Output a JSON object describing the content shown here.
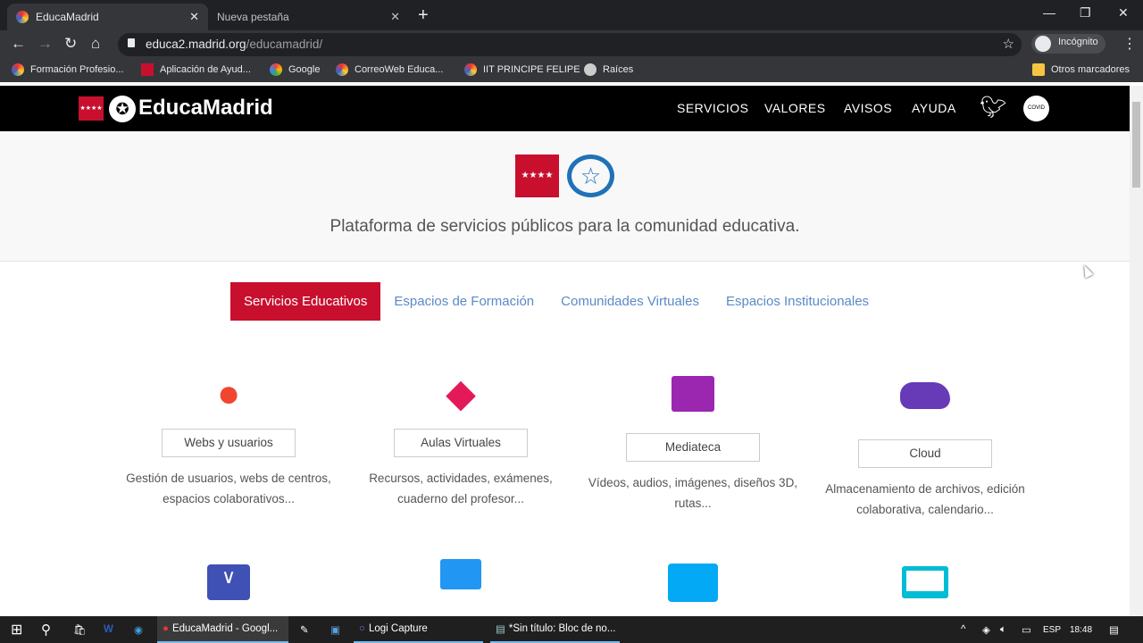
{
  "browser": {
    "tabs": [
      {
        "label": "EducaMadrid",
        "active": true
      },
      {
        "label": "Nueva pestaña",
        "active": false
      }
    ],
    "url_host": "educa2.madrid.org",
    "url_path": "/educamadrid/",
    "profile": "Incógnito",
    "bookmarks": [
      "Formación Profesio...",
      "Aplicación de Ayud...",
      "Google",
      "CorreoWeb Educa...",
      "IIT PRINCIPE FELIPE",
      "Raíces"
    ],
    "other_bookmarks": "Otros marcadores"
  },
  "site": {
    "logo": "EducaMadrid",
    "nav": [
      "SERVICIOS",
      "VALORES",
      "AVISOS",
      "AYUDA"
    ],
    "covid_badge": "COVID",
    "tagline": "Plataforma de servicios públicos para la comunidad educativa.",
    "tabs": [
      {
        "label": "Servicios Educativos",
        "selected": true
      },
      {
        "label": "Espacios de Formación"
      },
      {
        "label": "Comunidades Virtuales"
      },
      {
        "label": "Espacios Institucionales"
      }
    ],
    "cards": [
      {
        "title": "Webs y usuarios",
        "desc": "Gestión de usuarios, webs de centros, espacios colaborativos...",
        "icon": "users-icon",
        "color": "#f0452f"
      },
      {
        "title": "Aulas Virtuales",
        "desc": "Recursos, actividades, exámenes, cuaderno del profesor...",
        "icon": "graduation-cap-icon",
        "color": "#e3195a"
      },
      {
        "title": "Mediateca",
        "desc": "Vídeos, audios, imágenes, diseños 3D, rutas...",
        "icon": "clapperboard-icon",
        "color": "#9b27b0"
      },
      {
        "title": "Cloud",
        "desc": "Almacenamiento de archivos, edición colaborativa, calendario...",
        "icon": "cloud-icon",
        "color": "#673ab7"
      }
    ],
    "icons_row2": [
      {
        "icon": "mail-icon",
        "color": "#3f51b5"
      },
      {
        "icon": "chat-icon",
        "color": "#2196f3"
      },
      {
        "icon": "contact-card-icon",
        "color": "#03a9f4"
      },
      {
        "icon": "laptop-icon",
        "color": "#00bcd4"
      }
    ],
    "accent": "#c8102e"
  },
  "taskbar": {
    "apps": [
      "EducaMadrid - Googl...",
      "Logi Capture",
      "*Sin título: Bloc de no..."
    ],
    "lang": "ESP",
    "time": "18:48"
  }
}
